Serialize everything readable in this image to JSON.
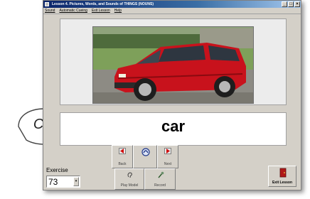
{
  "window": {
    "title": "Lesson 4.  Pictures, Words, and Sounds of THINGS (NOUNS)",
    "menu": [
      "Sound",
      "Automatic Cueing",
      "Exit Lesson",
      "Help"
    ]
  },
  "word_display": {
    "text": "car"
  },
  "speech_bubble": {
    "text": "Car"
  },
  "picture": {
    "subject": "red hatchback car",
    "icon": "car-photo"
  },
  "nav": {
    "back_label": "Back",
    "next_label": "Next",
    "play_model_label": "Play Model",
    "record_label": "Record"
  },
  "exercise": {
    "label": "Exercise",
    "value": "73"
  },
  "exit_lesson": {
    "label": "Exit Lesson"
  },
  "colors": {
    "car_red": "#c8121c",
    "title_blue": "#0a246a",
    "window_gray": "#d4d0c8"
  }
}
